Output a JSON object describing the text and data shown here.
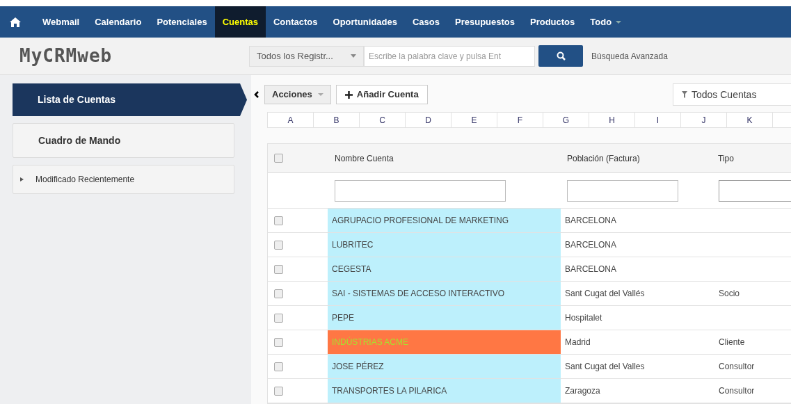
{
  "nav": {
    "items": [
      {
        "label": "Webmail",
        "selected": false
      },
      {
        "label": "Calendario",
        "selected": false
      },
      {
        "label": "Potenciales",
        "selected": false
      },
      {
        "label": "Cuentas",
        "selected": true
      },
      {
        "label": "Contactos",
        "selected": false
      },
      {
        "label": "Oportunidades",
        "selected": false
      },
      {
        "label": "Casos",
        "selected": false
      },
      {
        "label": "Presupuestos",
        "selected": false
      },
      {
        "label": "Productos",
        "selected": false
      }
    ],
    "more": "Todo"
  },
  "header": {
    "logo": "MyCRMweb",
    "scope": "Todos los Registr...",
    "search_placeholder": "Escribe la palabra clave y pulsa Ent",
    "advanced": "Búsqueda Avanzada"
  },
  "sidebar": {
    "items": [
      {
        "label": "Lista de Cuentas",
        "kind": "active"
      },
      {
        "label": "Cuadro de Mando",
        "kind": "card"
      },
      {
        "label": "Modificado Recientemente",
        "kind": "collapsible",
        "expanded": false
      }
    ]
  },
  "toolbar": {
    "actions": "Acciones",
    "add": "Añadir Cuenta",
    "filter": "Todos Cuentas"
  },
  "letters": [
    "A",
    "B",
    "C",
    "D",
    "E",
    "F",
    "G",
    "H",
    "I",
    "J",
    "K"
  ],
  "table": {
    "all_checked": false,
    "columns": [
      "Nombre Cuenta",
      "Población (Factura)",
      "Tipo"
    ],
    "rows": [
      {
        "checked": false,
        "cells": [
          "AGRUPACIO PROFESIONAL DE MARKETING",
          "BARCELONA",
          ""
        ],
        "color": "#bdf0fc",
        "kind": "normal"
      },
      {
        "checked": false,
        "cells": [
          "LUBRITEC",
          "BARCELONA",
          ""
        ],
        "color": "#bdf0fc",
        "kind": "normal"
      },
      {
        "checked": false,
        "cells": [
          "CEGESTA",
          "BARCELONA",
          ""
        ],
        "color": "#bdf0fc",
        "kind": "normal"
      },
      {
        "checked": false,
        "cells": [
          "SAI - SISTEMAS DE ACCESO INTERACTIVO",
          "Sant Cugat del Vallés",
          "Socio"
        ],
        "color": "#bdf0fc",
        "kind": "normal"
      },
      {
        "checked": false,
        "cells": [
          "PEPE",
          "Hospitalet",
          ""
        ],
        "color": "#bdf0fc",
        "kind": "normal"
      },
      {
        "checked": false,
        "cells": [
          "INDÚSTRIAS ACME",
          "Madrid",
          "Cliente"
        ],
        "color": "#ff7744",
        "kind": "highlighted"
      },
      {
        "checked": false,
        "cells": [
          "JOSE PÉREZ",
          "Sant Cugat del Valles",
          "Consultor"
        ],
        "color": "#bdf0fc",
        "kind": "normal"
      },
      {
        "checked": false,
        "cells": [
          "TRANSPORTES LA PILARICA",
          "Zaragoza",
          "Consultor"
        ],
        "color": "#bdf0fc",
        "kind": "normal"
      }
    ]
  }
}
